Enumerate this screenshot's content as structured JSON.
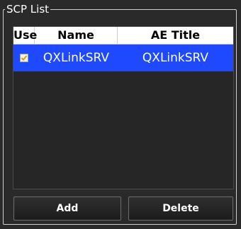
{
  "group": {
    "title": "SCP List"
  },
  "table": {
    "headers": [
      "Use",
      "Name",
      "AE Title"
    ],
    "rows": [
      {
        "use": true,
        "name": "QXLinkSRV",
        "ae_title": "QXLinkSRV"
      }
    ]
  },
  "buttons": {
    "add": "Add",
    "delete": "Delete"
  },
  "colors": {
    "selected_row": "#1f49ff",
    "checkmark": "#d9a400",
    "panel_background": "#262626"
  },
  "icons": {
    "row_checkbox": "checkbox-checked-icon"
  }
}
